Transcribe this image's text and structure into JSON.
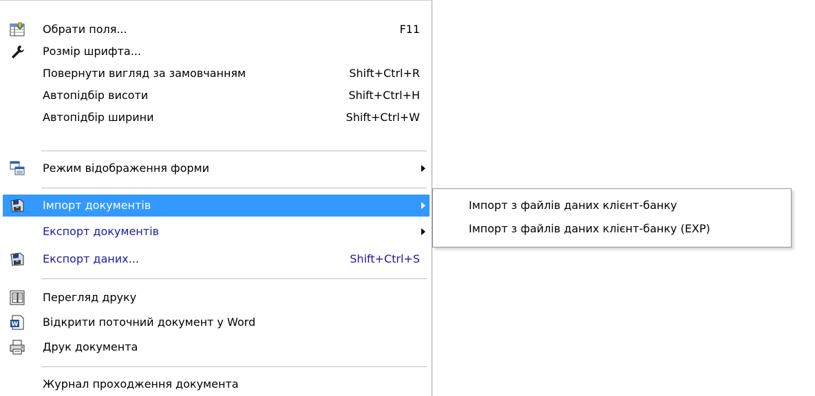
{
  "menu": {
    "items": [
      {
        "label": "Обрати поля...",
        "shortcut": "F11",
        "icon": "select-fields-icon"
      },
      {
        "label": "Розмір шрифта...",
        "shortcut": "",
        "icon": "wrench-icon"
      },
      {
        "label": "Повернути вигляд за замовчанням",
        "shortcut": "Shift+Ctrl+R"
      },
      {
        "label": "Автопідбір висоти",
        "shortcut": "Shift+Ctrl+H"
      },
      {
        "label": "Автопідбір ширини",
        "shortcut": "Shift+Ctrl+W"
      },
      {
        "label": "Режим відображення форми",
        "icon": "form-display-mode-icon",
        "submenu": true
      },
      {
        "label": "Імпорт документів",
        "icon": "import-disk-icon",
        "submenu": true,
        "highlighted": true
      },
      {
        "label": "Експорт документів",
        "submenu": true
      },
      {
        "label": "Експорт даних...",
        "shortcut": "Shift+Ctrl+S",
        "icon": "export-disk-icon"
      },
      {
        "label": "Перегляд друку",
        "icon": "print-preview-icon"
      },
      {
        "label": "Відкрити поточний документ у Word",
        "icon": "word-document-icon"
      },
      {
        "label": "Друк документа",
        "icon": "printer-icon"
      },
      {
        "label": "Журнал проходження документа"
      }
    ]
  },
  "submenu": {
    "items": [
      {
        "label": "Імпорт з файлів даних клієнт-банку"
      },
      {
        "label": "Імпорт з файлів даних клієнт-банку (EXP)"
      }
    ]
  },
  "colors": {
    "highlight": "#3399ff",
    "link_text": "#1a1aa6",
    "separator": "#bcbcbc"
  }
}
